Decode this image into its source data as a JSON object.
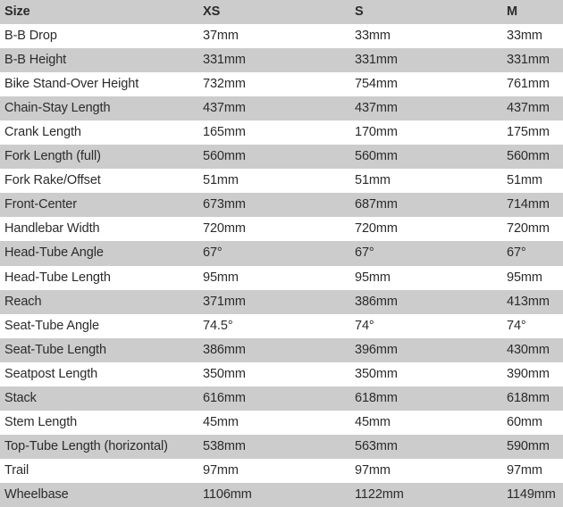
{
  "table": {
    "columns": [
      "Size",
      "XS",
      "S",
      "M"
    ],
    "rows": [
      {
        "label": "B-B Drop",
        "xs": "37mm",
        "s": "33mm",
        "m": "33mm"
      },
      {
        "label": "B-B Height",
        "xs": "331mm",
        "s": "331mm",
        "m": "331mm"
      },
      {
        "label": "Bike Stand-Over Height",
        "xs": "732mm",
        "s": "754mm",
        "m": "761mm"
      },
      {
        "label": "Chain-Stay Length",
        "xs": "437mm",
        "s": "437mm",
        "m": "437mm"
      },
      {
        "label": "Crank Length",
        "xs": "165mm",
        "s": "170mm",
        "m": "175mm"
      },
      {
        "label": "Fork Length (full)",
        "xs": "560mm",
        "s": "560mm",
        "m": "560mm"
      },
      {
        "label": "Fork Rake/Offset",
        "xs": "51mm",
        "s": "51mm",
        "m": "51mm"
      },
      {
        "label": "Front-Center",
        "xs": "673mm",
        "s": "687mm",
        "m": "714mm"
      },
      {
        "label": "Handlebar Width",
        "xs": "720mm",
        "s": "720mm",
        "m": "720mm"
      },
      {
        "label": "Head-Tube Angle",
        "xs": "67°",
        "s": "67°",
        "m": "67°"
      },
      {
        "label": "Head-Tube Length",
        "xs": "95mm",
        "s": "95mm",
        "m": "95mm"
      },
      {
        "label": "Reach",
        "xs": "371mm",
        "s": "386mm",
        "m": "413mm"
      },
      {
        "label": "Seat-Tube Angle",
        "xs": "74.5°",
        "s": "74°",
        "m": "74°"
      },
      {
        "label": "Seat-Tube Length",
        "xs": "386mm",
        "s": "396mm",
        "m": "430mm"
      },
      {
        "label": "Seatpost Length",
        "xs": "350mm",
        "s": "350mm",
        "m": "390mm"
      },
      {
        "label": "Stack",
        "xs": "616mm",
        "s": "618mm",
        "m": "618mm"
      },
      {
        "label": "Stem Length",
        "xs": "45mm",
        "s": "45mm",
        "m": "60mm"
      },
      {
        "label": "Top-Tube Length (horizontal)",
        "xs": "538mm",
        "s": "563mm",
        "m": "590mm"
      },
      {
        "label": "Trail",
        "xs": "97mm",
        "s": "97mm",
        "m": "97mm"
      },
      {
        "label": "Wheelbase",
        "xs": "1106mm",
        "s": "1122mm",
        "m": "1149mm"
      }
    ]
  },
  "colors": {
    "shade_row": "#cccccc",
    "plain_row": "#ffffff",
    "text": "#2b2b2b"
  }
}
